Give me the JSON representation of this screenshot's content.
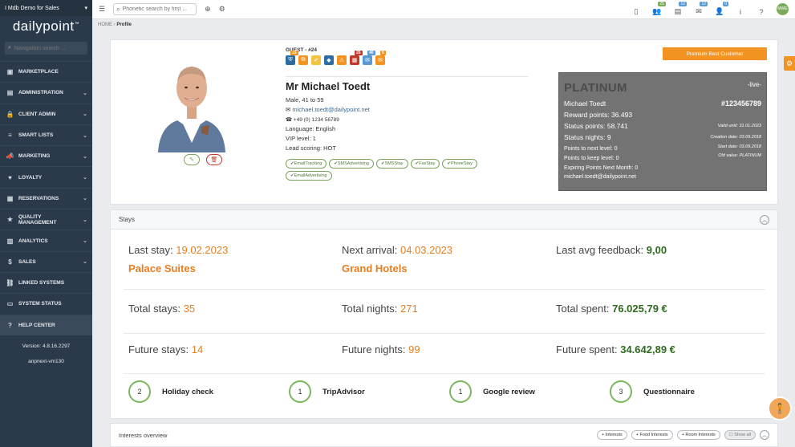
{
  "sidebar": {
    "org": "I Mdb Demo for Sales",
    "logo": "dailypoint",
    "logo_tm": "™",
    "search_placeholder": "Navigation search ...",
    "items": [
      {
        "label": "MARKETPLACE",
        "icon": "store-icon",
        "chevron": false
      },
      {
        "label": "ADMINISTRATION",
        "icon": "briefcase-icon",
        "chevron": true
      },
      {
        "label": "CLIENT ADMIN",
        "icon": "lock-icon",
        "chevron": true
      },
      {
        "label": "SMART LISTS",
        "icon": "list-icon",
        "chevron": true
      },
      {
        "label": "MARKETING",
        "icon": "megaphone-icon",
        "chevron": true
      },
      {
        "label": "LOYALTY",
        "icon": "heart-icon",
        "chevron": true
      },
      {
        "label": "RESERVATIONS",
        "icon": "calendar-icon",
        "chevron": true
      },
      {
        "label": "QUALITY MANAGEMENT",
        "icon": "star-icon",
        "chevron": true
      },
      {
        "label": "ANALYTICS",
        "icon": "chart-icon",
        "chevron": true
      },
      {
        "label": "SALES",
        "icon": "dollar-icon",
        "chevron": true
      },
      {
        "label": "LINKED SYSTEMS",
        "icon": "link-icon",
        "chevron": false
      },
      {
        "label": "SYSTEM STATUS",
        "icon": "monitor-icon",
        "chevron": false
      },
      {
        "label": "HELP CENTER",
        "icon": "help-icon",
        "chevron": false
      }
    ],
    "version": "Version: 4.8.16.2297",
    "env": "anpnext-vm130"
  },
  "topbar": {
    "search_placeholder": "Phonetic search by first ...",
    "badges": [
      {
        "icon": "tablet-icon",
        "count": "",
        "color": "#7bab5a"
      },
      {
        "icon": "users-icon",
        "count": "25",
        "color": "#7bab5a"
      },
      {
        "icon": "document-icon",
        "count": "12",
        "color": "#5b9bd5"
      },
      {
        "icon": "chat-icon",
        "count": "12",
        "color": "#5b9bd5"
      },
      {
        "icon": "user-icon",
        "count": "0",
        "color": "#5b9bd5"
      },
      {
        "icon": "info-icon",
        "count": "",
        "color": ""
      },
      {
        "icon": "help-icon",
        "count": "",
        "color": ""
      }
    ],
    "avatar_initials": "MWE"
  },
  "breadcrumb": {
    "home": "HOME",
    "sep": " › ",
    "current": "Profile"
  },
  "profile": {
    "guest_label": "GUEST - #24",
    "icons": [
      {
        "icon": "shield-icon",
        "badge": "15",
        "bg": "#2e6da4",
        "badge_color": "#f39422"
      },
      {
        "icon": "tags-icon",
        "badge": "",
        "bg": "#f39422",
        "badge_color": ""
      },
      {
        "icon": "check-icon",
        "badge": "",
        "bg": "#f5c342",
        "badge_color": ""
      },
      {
        "icon": "tag-icon",
        "badge": "",
        "bg": "#2e6da4",
        "badge_color": ""
      },
      {
        "icon": "warning-icon",
        "badge": "",
        "bg": "#f39422",
        "badge_color": ""
      },
      {
        "icon": "calendar-icon",
        "badge": "25",
        "bg": "#c0392b",
        "badge_color": "#c0392b"
      },
      {
        "icon": "chat-icon",
        "badge": "40",
        "bg": "#5b9bd5",
        "badge_color": "#5b9bd5"
      },
      {
        "icon": "comment-icon",
        "badge": "5",
        "bg": "#f39422",
        "badge_color": "#f39422"
      }
    ],
    "name": "Mr Michael Toedt",
    "gender_age": "Male, 41 to 59",
    "email": "michael.toedt@dailypoint.net",
    "phone": "+49 (0) 1234 56789",
    "language": "Language: English",
    "vip": "VIP level: 1",
    "lead": "Lead scoring: HOT",
    "tags": [
      "EmailTracking",
      "SMSAdvertising",
      "SMSStay",
      "FaxStay",
      "PhoneStay",
      "EmailAdvertising"
    ],
    "premium_label": "Premium Best Customer"
  },
  "loyalty": {
    "tier": "PLATINUM",
    "live": "-live-",
    "member": "Michael Toedt",
    "member_id": "#123456789",
    "reward": "Reward points: 36.493",
    "status_points": "Status points: 58.741",
    "status_nights": "Status nights: 9",
    "next_level": "Points to next level: 0",
    "keep_level": "Points to keep level: 0",
    "expiring": "Expiring Points Next Month: 0",
    "email": "michael.toedt@dailypoint.net",
    "valid_until": "Valid until: 31.01.2023",
    "creation": "Creation date: 03.09.2018",
    "start": "Start date: 03.09.2018",
    "old_value": "Old value: PLATINUM"
  },
  "stays": {
    "title": "Stays",
    "last_stay_label": "Last stay: ",
    "last_stay_date": "19.02.2023",
    "last_stay_hotel": "Palace Suites",
    "next_arrival_label": "Next arrival: ",
    "next_arrival_date": "04.03.2023",
    "next_arrival_hotel": "Grand Hotels",
    "feedback_label": "Last avg feedback: ",
    "feedback_value": "9,00",
    "total_stays_label": "Total stays: ",
    "total_stays": "35",
    "total_nights_label": "Total nights: ",
    "total_nights": "271",
    "total_spent_label": "Total spent: ",
    "total_spent": "76.025,79 €",
    "future_stays_label": "Future stays: ",
    "future_stays": "14",
    "future_nights_label": "Future nights: ",
    "future_nights": "99",
    "future_spent_label": "Future spent: ",
    "future_spent": "34.642,89 €",
    "reviews": [
      {
        "count": "2",
        "label": "Holiday check"
      },
      {
        "count": "1",
        "label": "TripAdvisor"
      },
      {
        "count": "1",
        "label": "Google review"
      },
      {
        "count": "3",
        "label": "Questionnaire"
      }
    ]
  },
  "interests": {
    "title": "Interests overview",
    "buttons": [
      "+ Interests",
      "+ Food Interests",
      "+ Room Interests"
    ],
    "show_all": "Show all"
  }
}
